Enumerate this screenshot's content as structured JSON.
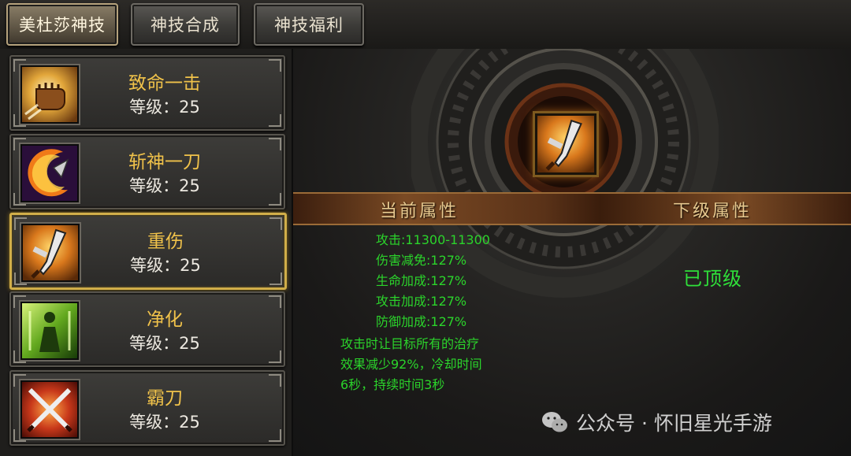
{
  "tabs": [
    {
      "label": "美杜莎神技",
      "active": true
    },
    {
      "label": "神技合成",
      "active": false
    },
    {
      "label": "神技福利",
      "active": false
    }
  ],
  "skills": [
    {
      "name": "致命一击",
      "level": "等级：25",
      "icon": "fist-icon"
    },
    {
      "name": "斩神一刀",
      "level": "等级：25",
      "icon": "crescent-blade-icon"
    },
    {
      "name": "重伤",
      "level": "等级：25",
      "icon": "broken-blade-icon",
      "selected": true
    },
    {
      "name": "净化",
      "level": "等级：25",
      "icon": "purify-figure-icon"
    },
    {
      "name": "霸刀",
      "level": "等级：25",
      "icon": "crossed-blades-icon"
    }
  ],
  "detail": {
    "current_header": "当前属性",
    "next_header": "下级属性",
    "stats": [
      "攻击:11300-11300",
      "伤害减免:127%",
      "生命加成:127%",
      "攻击加成:127%",
      "防御加成:127%"
    ],
    "effect_lines": [
      "攻击时让目标所有的治疗",
      "效果减少92%，冷却时间",
      "6秒，持续时间3秒"
    ],
    "next_level_text": "已顶级"
  },
  "watermark": {
    "text": "公众号 · 怀旧星光手游"
  },
  "colors": {
    "accent_gold": "#f0c24a",
    "stat_green": "#2bd42b",
    "selected_border": "#d1ae49"
  }
}
